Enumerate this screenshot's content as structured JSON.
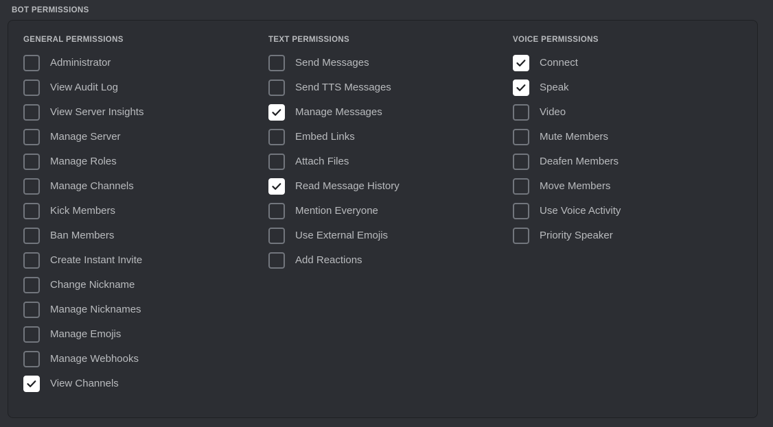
{
  "header": {
    "title": "BOT PERMISSIONS"
  },
  "colors": {
    "page_background": "#2f3136",
    "panel_background": "#2c2e33",
    "panel_border": "#1f2124",
    "label_text": "#b9bbbe",
    "checkbox_border": "#72767d",
    "checkbox_checked_fill": "#ffffff",
    "checkmark": "#1e1f22"
  },
  "columns": [
    {
      "id": "general",
      "title": "GENERAL PERMISSIONS",
      "items": [
        {
          "label": "Administrator",
          "checked": false
        },
        {
          "label": "View Audit Log",
          "checked": false
        },
        {
          "label": "View Server Insights",
          "checked": false
        },
        {
          "label": "Manage Server",
          "checked": false
        },
        {
          "label": "Manage Roles",
          "checked": false
        },
        {
          "label": "Manage Channels",
          "checked": false
        },
        {
          "label": "Kick Members",
          "checked": false
        },
        {
          "label": "Ban Members",
          "checked": false
        },
        {
          "label": "Create Instant Invite",
          "checked": false
        },
        {
          "label": "Change Nickname",
          "checked": false
        },
        {
          "label": "Manage Nicknames",
          "checked": false
        },
        {
          "label": "Manage Emojis",
          "checked": false
        },
        {
          "label": "Manage Webhooks",
          "checked": false
        },
        {
          "label": "View Channels",
          "checked": true
        }
      ]
    },
    {
      "id": "text",
      "title": "TEXT PERMISSIONS",
      "items": [
        {
          "label": "Send Messages",
          "checked": false
        },
        {
          "label": "Send TTS Messages",
          "checked": false
        },
        {
          "label": "Manage Messages",
          "checked": true
        },
        {
          "label": "Embed Links",
          "checked": false
        },
        {
          "label": "Attach Files",
          "checked": false
        },
        {
          "label": "Read Message History",
          "checked": true
        },
        {
          "label": "Mention Everyone",
          "checked": false
        },
        {
          "label": "Use External Emojis",
          "checked": false
        },
        {
          "label": "Add Reactions",
          "checked": false
        }
      ]
    },
    {
      "id": "voice",
      "title": "VOICE PERMISSIONS",
      "items": [
        {
          "label": "Connect",
          "checked": true
        },
        {
          "label": "Speak",
          "checked": true
        },
        {
          "label": "Video",
          "checked": false
        },
        {
          "label": "Mute Members",
          "checked": false
        },
        {
          "label": "Deafen Members",
          "checked": false
        },
        {
          "label": "Move Members",
          "checked": false
        },
        {
          "label": "Use Voice Activity",
          "checked": false
        },
        {
          "label": "Priority Speaker",
          "checked": false
        }
      ]
    }
  ]
}
